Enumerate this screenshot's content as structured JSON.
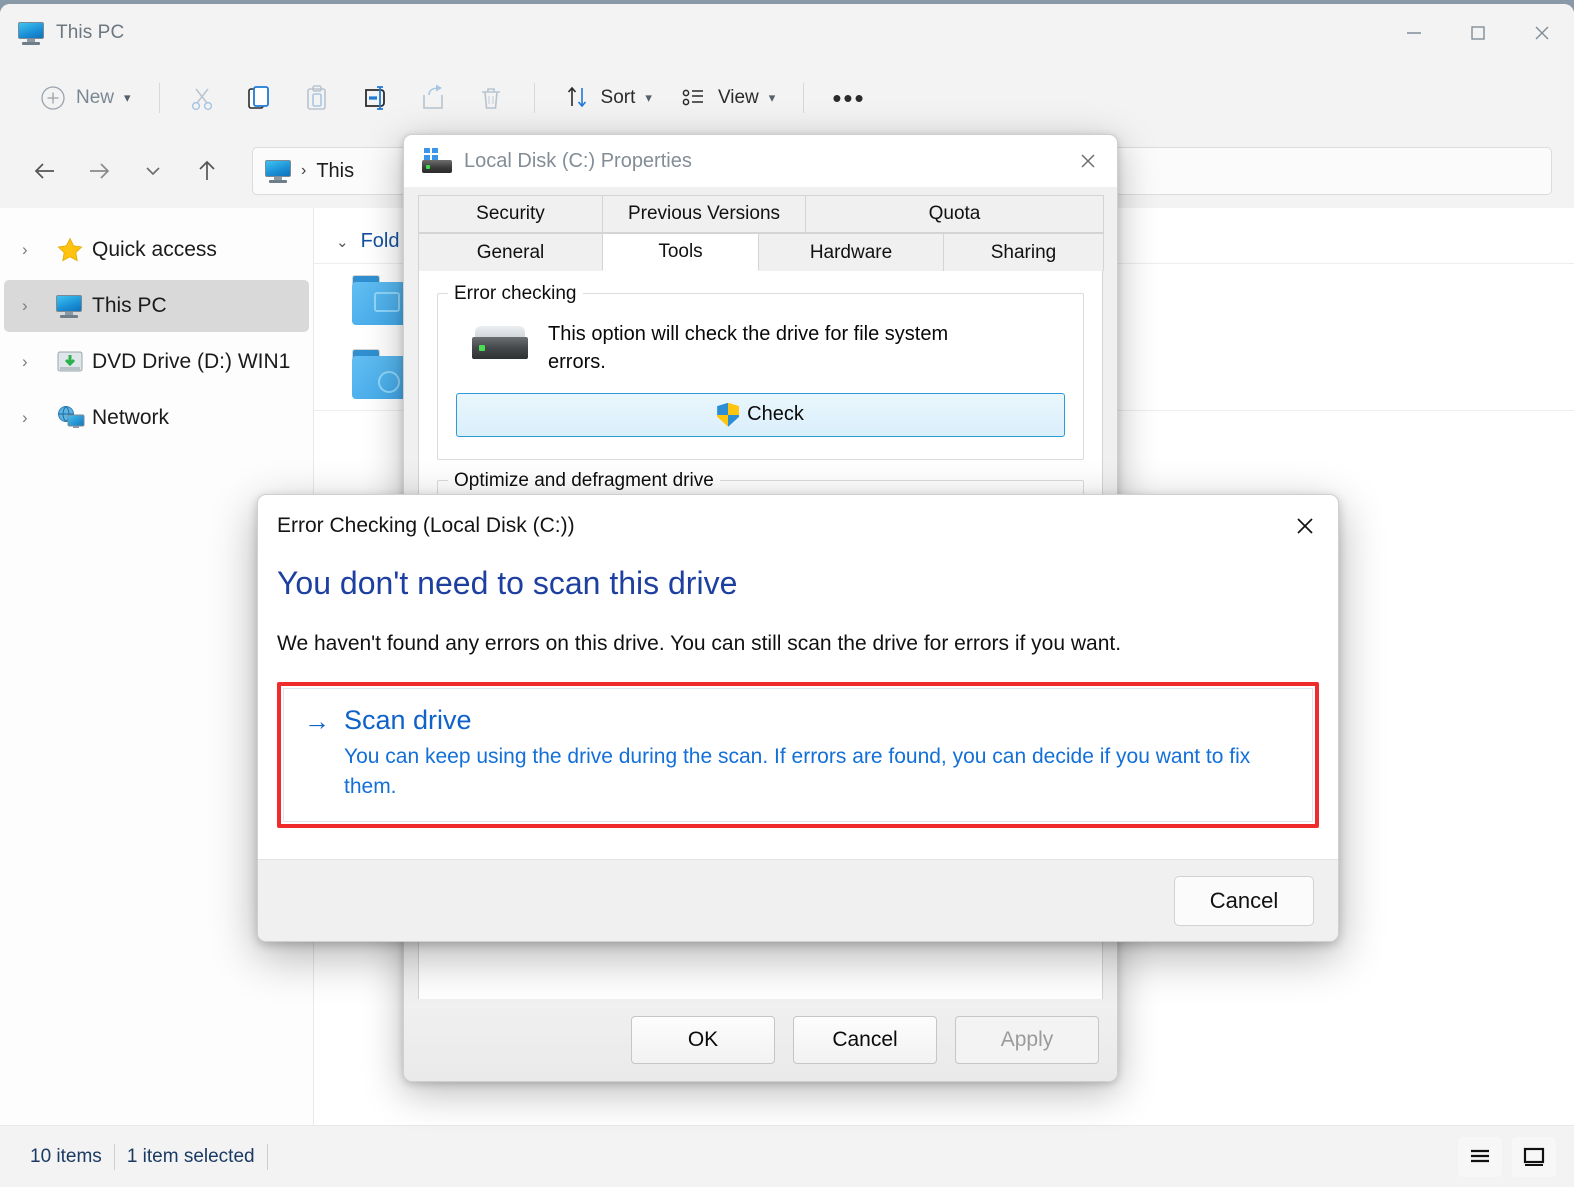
{
  "window": {
    "title": "This PC",
    "icon": "this-pc-icon",
    "controls": {
      "minimize": "—",
      "maximize": "□",
      "close": "✕"
    }
  },
  "toolbar": {
    "new_label": "New",
    "cut_icon": "scissors-icon",
    "copy_icon": "copy-icon",
    "paste_icon": "paste-icon",
    "rename_icon": "rename-icon",
    "share_icon": "share-icon",
    "delete_icon": "trash-icon",
    "sort_label": "Sort",
    "view_label": "View",
    "more_label": "•••",
    "chevron": "⌄"
  },
  "navbar": {
    "back_icon": "arrow-left-icon",
    "forward_icon": "arrow-right-icon",
    "recent_icon": "chevron-down-icon",
    "up_icon": "arrow-up-icon",
    "breadcrumb_icon": "this-pc-icon",
    "breadcrumb_text": "This",
    "breadcrumb_sep": "›"
  },
  "sidebar": {
    "items": [
      {
        "label": "Quick access",
        "icon": "star-icon",
        "chevron": "›",
        "selected": false
      },
      {
        "label": "This PC",
        "icon": "this-pc-icon",
        "chevron": "›",
        "selected": true
      },
      {
        "label": "DVD Drive (D:) WIN1",
        "icon": "dvd-drive-icon",
        "chevron": "›",
        "selected": false
      },
      {
        "label": "Network",
        "icon": "network-icon",
        "chevron": "›",
        "selected": false
      }
    ]
  },
  "content": {
    "group_header": "Fold",
    "group_chevron": "⌄"
  },
  "statusbar": {
    "items_count": "10 items",
    "selection": "1 item selected",
    "details_view_icon": "details-view-icon",
    "large_icons_view_icon": "large-icons-view-icon"
  },
  "properties_dialog": {
    "title": "Local Disk (C:) Properties",
    "icon": "local-disk-icon",
    "close_icon": "close-icon",
    "tabs_row1": [
      {
        "label": "Security",
        "active": false
      },
      {
        "label": "Previous Versions",
        "active": false
      },
      {
        "label": "Quota",
        "active": false
      }
    ],
    "tabs_row2": [
      {
        "label": "General",
        "active": false
      },
      {
        "label": "Tools",
        "active": true
      },
      {
        "label": "Hardware",
        "active": false
      },
      {
        "label": "Sharing",
        "active": false
      }
    ],
    "error_checking": {
      "group_title": "Error checking",
      "description": "This option will check the drive for file system errors.",
      "check_button": "Check",
      "shield_icon": "uac-shield-icon",
      "drive_icon": "hard-drive-icon"
    },
    "optimize": {
      "group_title": "Optimize and defragment drive"
    },
    "footer": {
      "ok": "OK",
      "cancel": "Cancel",
      "apply": "Apply"
    }
  },
  "error_checking_dialog": {
    "title": "Error Checking (Local Disk (C:))",
    "close_icon": "close-icon",
    "heading": "You don't need to scan this drive",
    "subtext": "We haven't found any errors on this drive. You can still scan the drive for errors if you want.",
    "scan_option": {
      "arrow_icon": "arrow-right-icon",
      "title": "Scan drive",
      "description": "You can keep using the drive during the scan. If errors are found, you can decide if you want to fix them.",
      "highlight_color": "#ef2b2b"
    },
    "cancel": "Cancel"
  },
  "colors": {
    "accent_blue": "#0f63c8",
    "heading_blue": "#1d3fa0",
    "highlight_red": "#ef2b2b",
    "window_chrome": "#f3f3f3"
  }
}
